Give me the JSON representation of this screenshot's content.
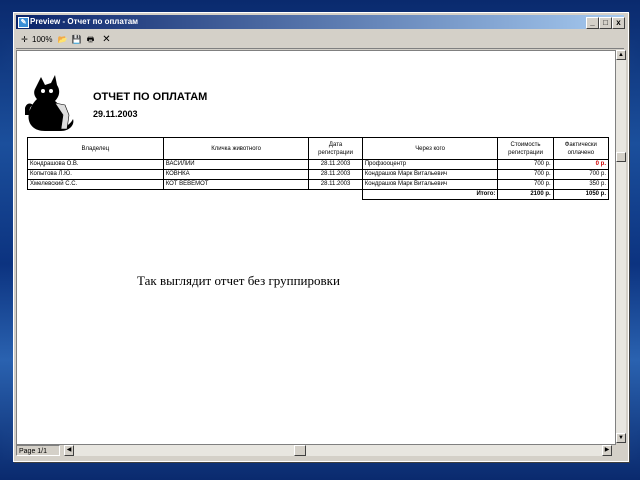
{
  "window": {
    "title": "Preview - Отчет по оплатам",
    "app_icon": "report-icon"
  },
  "titlebar_buttons": [
    "_",
    "□",
    "x"
  ],
  "toolbar": {
    "zoom": "100%",
    "items": [
      "fit-icon",
      "open-icon",
      "save-icon",
      "print-icon",
      "close-icon"
    ]
  },
  "report": {
    "title": "ОТЧЕТ ПО ОПЛАТАМ",
    "date": "29.11.2003",
    "logo": "black-cat-logo",
    "columns": [
      "Владелец",
      "Кличка животного",
      "Дата регистрации",
      "Через кого",
      "Стоимость регистрации",
      "Фактически оплачено"
    ],
    "rows": [
      [
        "Кондрашова О.В.",
        "ВАСИЛИЙ",
        "28.11.2003",
        "Профзооцентр",
        "700 р.",
        "0 р."
      ],
      [
        "Копытова Л.Ю.",
        "КОВНКА",
        "28.11.2003",
        "Кондрашов Марк Витальевич",
        "700 р.",
        "700 р."
      ],
      [
        "Хмелевский С.С.",
        "КОТ ВЕВЕМОТ",
        "28.11.2003",
        "Кондрашов Марк Витальевич",
        "700 р.",
        "350 р."
      ]
    ],
    "total": {
      "label": "Итого:",
      "cost": "2100 р.",
      "paid": "1050 р."
    }
  },
  "caption": "Так выглядит отчет без группировки",
  "statusbar": {
    "page": "Page 1/1"
  },
  "colors": {
    "titlebar_start": "#0a246a",
    "highlight_value": "#d00000"
  }
}
